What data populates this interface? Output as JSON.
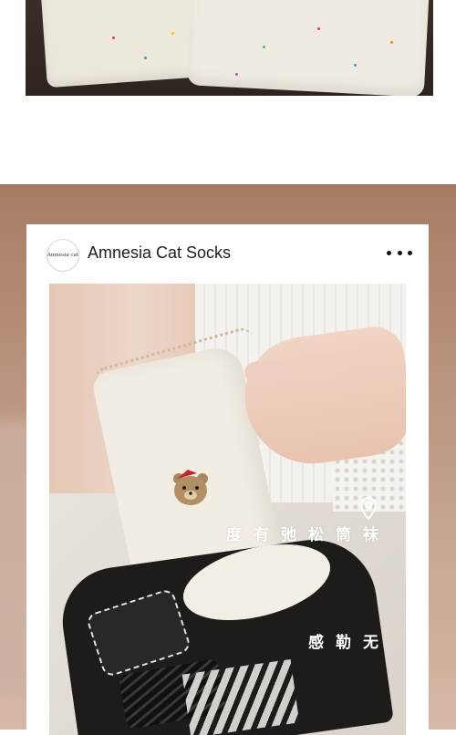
{
  "card": {
    "avatar_text": "Amnesia cat",
    "account_name": "Amnesia Cat Socks",
    "more_icon": "more-dots-icon"
  },
  "caption": {
    "location_icon": "location-pin-icon",
    "line1": "袜筒松弛有度",
    "line2": "无勒感"
  },
  "colors": {
    "background_top": "#ffffff",
    "card_background": "#ffffff",
    "caption_text": "#ffffff",
    "bg_brown": "#a77c63"
  }
}
